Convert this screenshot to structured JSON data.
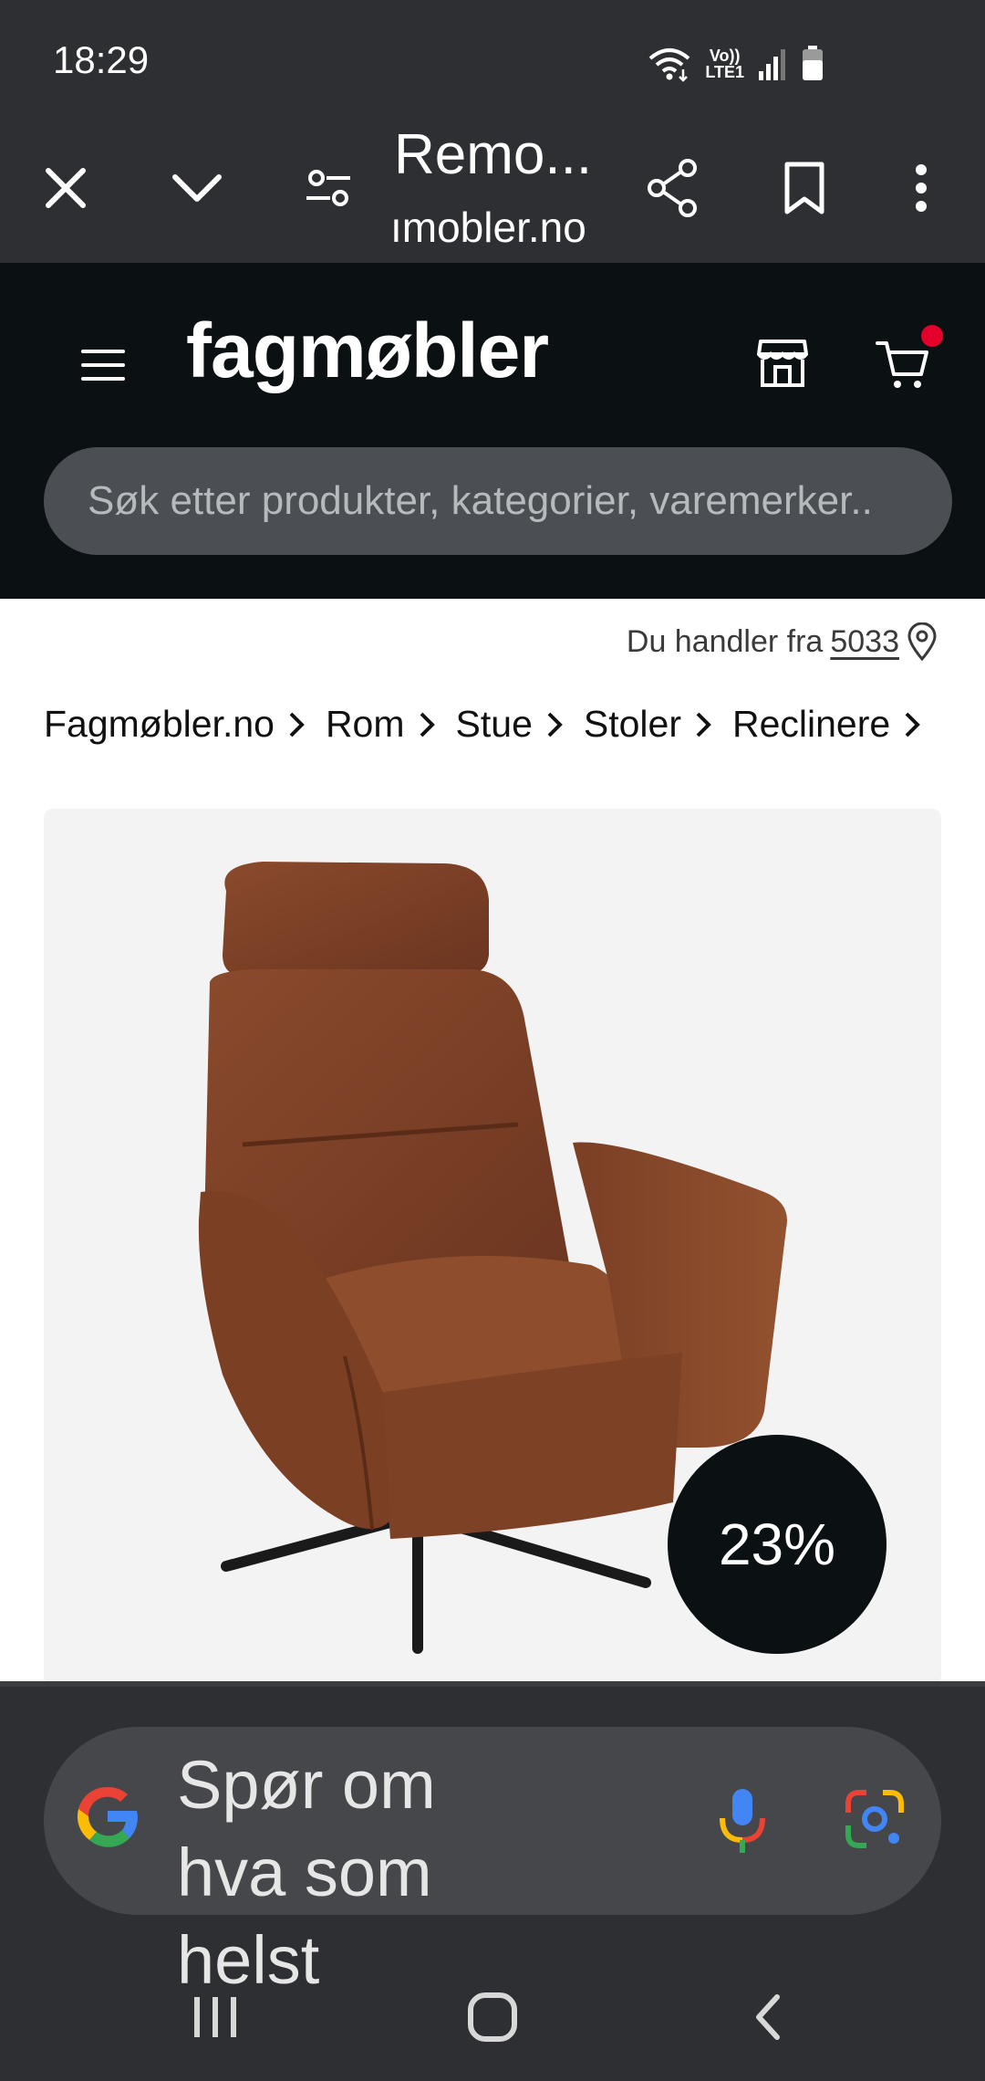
{
  "status_bar": {
    "time": "18:29",
    "network_label_top": "Vo))",
    "network_label_bottom": "LTE1",
    "icons": [
      "wifi-icon",
      "signal-icon",
      "battery-icon"
    ]
  },
  "browser": {
    "tab_title": "Remo...",
    "url": "ımobler.no",
    "icons": [
      "close-icon",
      "chevron-down-icon",
      "tune-icon",
      "share-icon",
      "bookmark-icon",
      "more-vert-icon"
    ]
  },
  "site": {
    "logo": "fagmøbler",
    "search_placeholder": "Søk etter produkter, kategorier, varemerker..",
    "location_prefix": "Du handler fra",
    "zip": "5033",
    "breadcrumb": [
      "Fagmøbler.no",
      "Rom",
      "Stue",
      "Stoler",
      "Reclinere"
    ],
    "discount_badge": "23%",
    "colors": {
      "header_bg": "#0b1013",
      "cart_dot": "#e4002b",
      "product_bg": "#f3f3f3"
    }
  },
  "google_bar": {
    "prompt": "Spør om hva som helst",
    "icons": [
      "google-g-icon",
      "mic-icon",
      "lens-icon"
    ]
  },
  "nav_bar": {
    "icons": [
      "recents-icon",
      "home-icon",
      "back-icon"
    ]
  }
}
